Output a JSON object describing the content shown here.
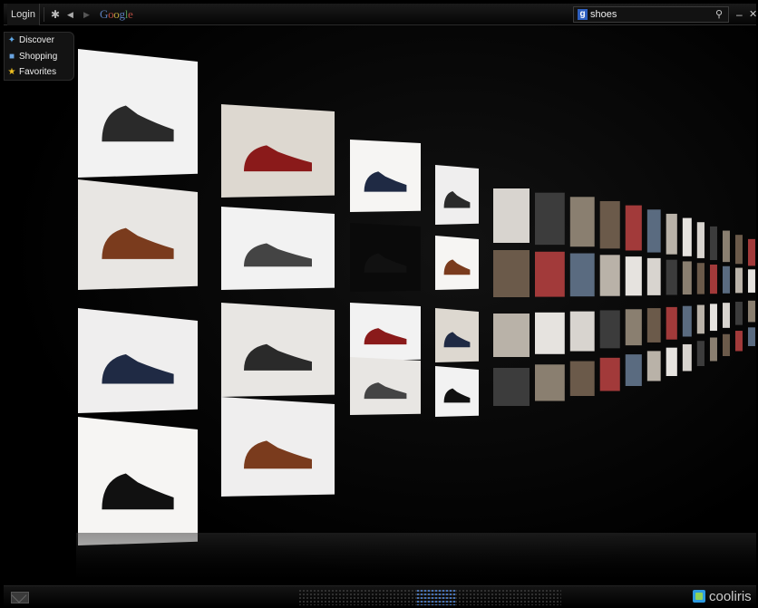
{
  "toolbar": {
    "login_label": "Login",
    "gear_icon": "gear-icon",
    "back_icon": "back-arrow-icon",
    "forward_icon": "forward-arrow-icon",
    "search_provider": "Google",
    "search_query": "shoes",
    "search_button_icon": "search-icon",
    "minimize_icon": "minimize-icon",
    "close_icon": "close-icon"
  },
  "sidebar": {
    "items": [
      {
        "label": "Discover",
        "icon": "sparkle-icon"
      },
      {
        "label": "Shopping",
        "icon": "shopping-bag-icon"
      },
      {
        "label": "Favorites",
        "icon": "star-icon"
      }
    ]
  },
  "footer": {
    "mail_icon": "mail-icon",
    "brand": "cooliris",
    "accent": "#4a78c0"
  },
  "results": {
    "query": "shoes",
    "rows": 4
  }
}
